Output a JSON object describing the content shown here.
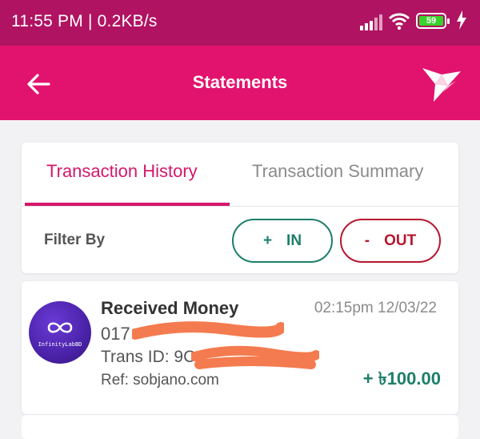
{
  "status_bar": {
    "time": "11:55 PM | 0.2KB/s",
    "battery_level": "59",
    "icons": [
      "signal-icon",
      "wifi-icon",
      "battery-icon",
      "charging-bolt-icon"
    ]
  },
  "app_bar": {
    "title": "Statements",
    "icons": [
      "back-arrow-icon",
      "bkash-bird-logo-icon"
    ]
  },
  "tabs": [
    {
      "label": "Transaction History",
      "active": true
    },
    {
      "label": "Transaction Summary",
      "active": false
    }
  ],
  "filter": {
    "label": "Filter By",
    "in_sign": "+",
    "in_label": "IN",
    "out_sign": "-",
    "out_label": "OUT"
  },
  "transactions": [
    {
      "type": "Received Money",
      "date": "02:15pm 12/03/22",
      "number": "017",
      "trans_id": "Trans ID: 9C",
      "ref": "Ref: sobjano.com",
      "amount": "+ ৳100.00",
      "avatar_text": "InfinityLabBD"
    }
  ],
  "colors": {
    "brand": "#e2136e",
    "status_bar": "#b01361",
    "in_green": "#1d7f6a",
    "out_red": "#b5172f",
    "redaction": "#f47b4f"
  }
}
